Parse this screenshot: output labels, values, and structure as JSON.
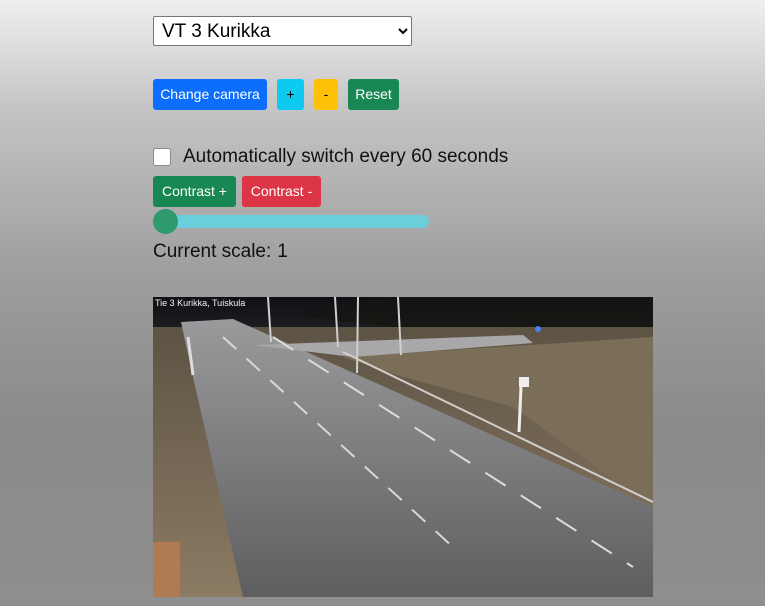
{
  "camera_select": {
    "selected": "VT 3 Kurikka"
  },
  "controls": {
    "change_camera": "Change camera",
    "zoom_in": "+",
    "zoom_out": "-",
    "reset": "Reset"
  },
  "auto_switch": {
    "checked": false,
    "label": "Automatically switch every 60 seconds"
  },
  "contrast": {
    "increase": "Contrast +",
    "decrease": "Contrast -"
  },
  "scale_slider": {
    "value_fraction": 0.0
  },
  "scale": {
    "label": "Current scale:",
    "value": "1"
  },
  "camera_image": {
    "overlay_text": "Tie 3 Kurikka, Tuiskula"
  },
  "colors": {
    "primary": "#0d6efd",
    "info": "#0dcaf0",
    "warning": "#ffc107",
    "success": "#198754",
    "danger": "#dc3545"
  }
}
